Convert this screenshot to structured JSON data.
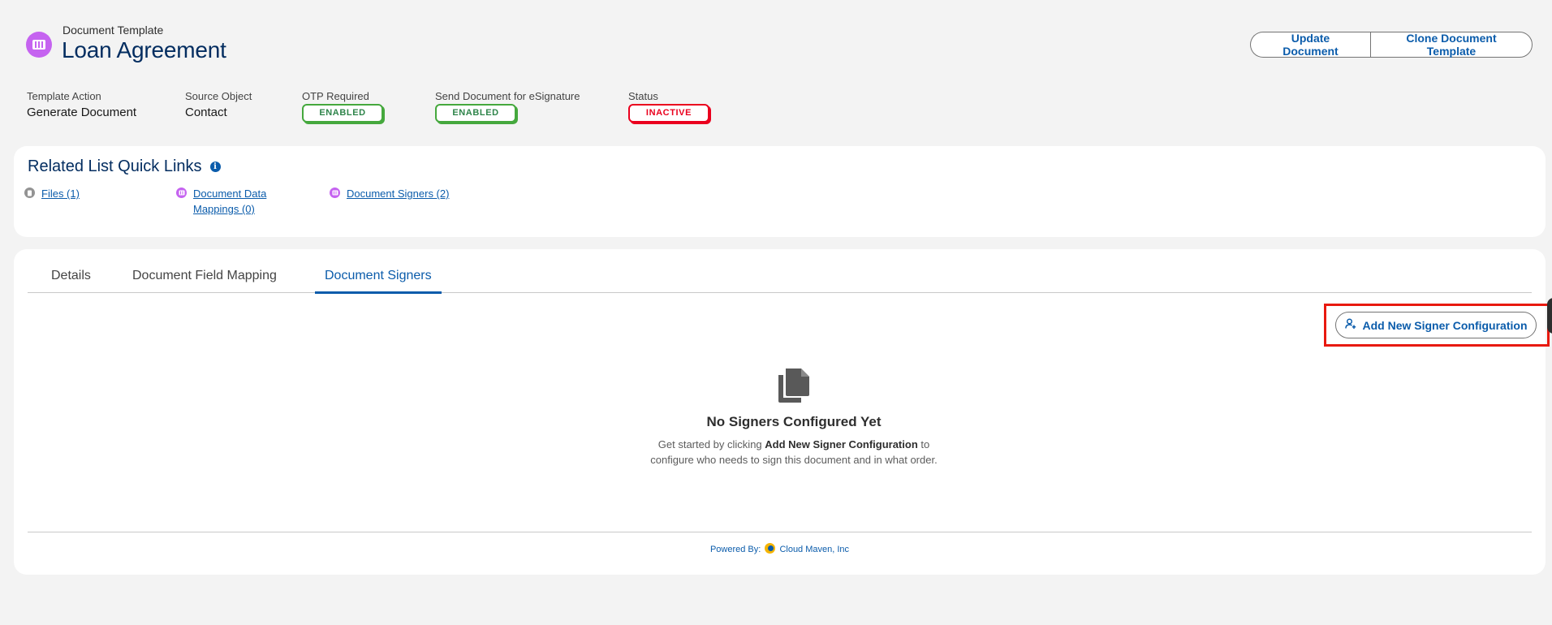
{
  "header": {
    "eyebrow": "Document Template",
    "title": "Loan Agreement",
    "icon": "template-book-icon",
    "buttons": {
      "update": "Update Document",
      "clone": "Clone Document Template"
    }
  },
  "fields": [
    {
      "label": "Template Action",
      "value": "Generate Document"
    },
    {
      "label": "Source Object",
      "value": "Contact"
    },
    {
      "label": "OTP Required",
      "badge": "ENABLED"
    },
    {
      "label": "Send Document for eSignature",
      "badge": "ENABLED"
    },
    {
      "label": "Status",
      "badge": "INACTIVE"
    }
  ],
  "related": {
    "heading": "Related List Quick Links",
    "links": [
      {
        "label": "Files (1)",
        "icon": "file-icon"
      },
      {
        "label_line1": "Document Data",
        "label_line2": "Mappings (0)",
        "icon": "template-book-icon"
      },
      {
        "label": "Document Signers (2)",
        "icon": "template-book-icon"
      }
    ]
  },
  "tabs": [
    {
      "label": "Details",
      "active": false
    },
    {
      "label": "Document Field Mapping",
      "active": false
    },
    {
      "label": "Document Signers",
      "active": true
    }
  ],
  "signers": {
    "add_button": "Add New Signer Configuration",
    "empty_title": "No Signers Configured Yet",
    "empty_desc_before": "Get started by clicking ",
    "empty_desc_bold": "Add New Signer Configuration",
    "empty_desc_after": " to configure who needs to sign this document and in what order."
  },
  "footer": {
    "powered_by": "Powered By:",
    "company": "Cloud Maven, Inc"
  },
  "colors": {
    "brand_blue": "#0b5cab",
    "title_navy": "#032d60",
    "template_purple": "#c563f0",
    "enabled_green": "#2e844a",
    "inactive_red": "#ea001e",
    "highlight_red": "#e8190f"
  }
}
